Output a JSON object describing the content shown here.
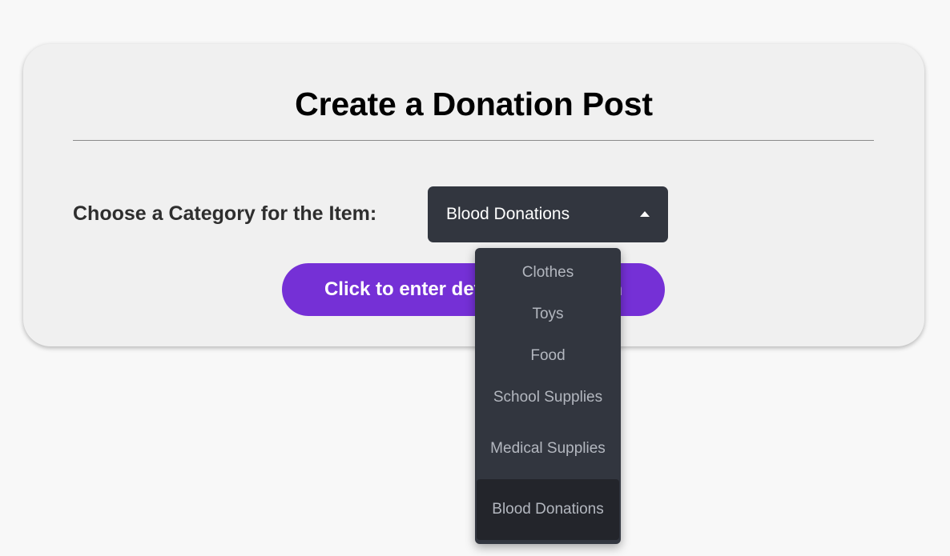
{
  "form": {
    "title": "Create a Donation Post",
    "category_label": "Choose a Category for the Item:",
    "selected_category": "Blood Donations",
    "enter_button_label": "Click to enter details of donation"
  },
  "dropdown": {
    "options": [
      "Clothes",
      "Toys",
      "Food",
      "School Supplies",
      "Medical Supplies",
      "Blood Donations"
    ],
    "selected_index": 5
  },
  "colors": {
    "page_bg": "#f8f8f8",
    "card_bg": "#f0f0f0",
    "select_bg": "#32363f",
    "button_bg": "#7530d6",
    "option_text": "#b3b7bf",
    "selected_option_bg": "#23252b"
  },
  "icons": {
    "select_caret": "caret-up-icon"
  }
}
